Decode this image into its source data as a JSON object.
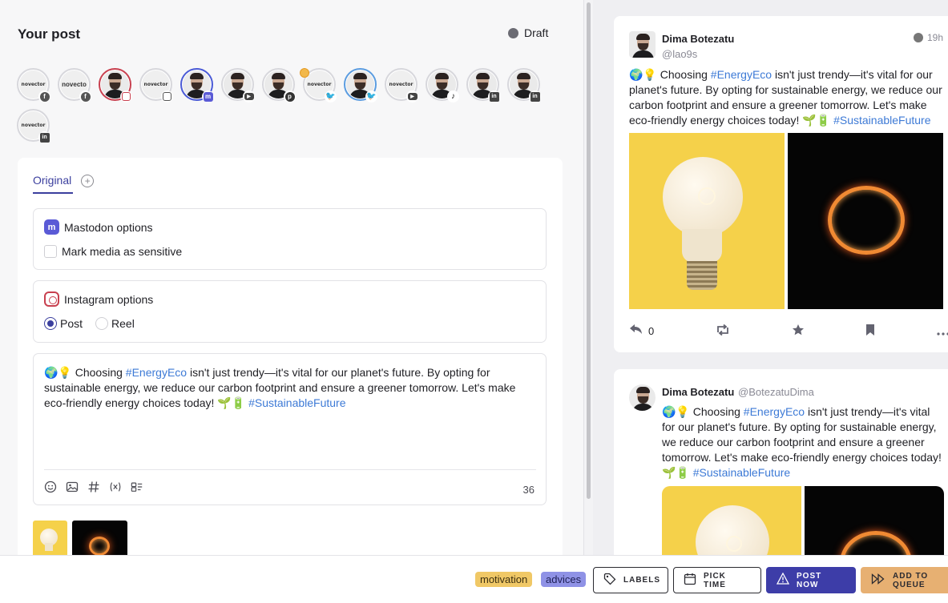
{
  "header": {
    "title": "Your post",
    "status": "Draft"
  },
  "accounts": [
    {
      "kind": "logo",
      "text": "novector",
      "network": "fb",
      "ring": "plain"
    },
    {
      "kind": "logo2",
      "text": "novecto",
      "network": "fb",
      "ring": "plain"
    },
    {
      "kind": "face",
      "network": "ig-red",
      "ring": "red"
    },
    {
      "kind": "logo",
      "text": "novector",
      "network": "ig",
      "ring": "plain"
    },
    {
      "kind": "face",
      "network": "md",
      "ring": "blue"
    },
    {
      "kind": "face",
      "network": "yt",
      "ring": "plain"
    },
    {
      "kind": "face",
      "network": "pt",
      "ring": "plain"
    },
    {
      "kind": "logo",
      "text": "novector",
      "network": "tw",
      "ring": "plain",
      "coin": true
    },
    {
      "kind": "face",
      "network": "twb",
      "ring": "tw"
    },
    {
      "kind": "logo",
      "text": "novector",
      "network": "yt",
      "ring": "plain"
    },
    {
      "kind": "face",
      "network": "tk",
      "ring": "plain"
    },
    {
      "kind": "face",
      "network": "li",
      "ring": "plain"
    },
    {
      "kind": "face",
      "network": "li",
      "ring": "plain"
    },
    {
      "kind": "logo",
      "text": "novector",
      "network": "li",
      "ring": "plain"
    }
  ],
  "editor": {
    "tab_original": "Original",
    "tab_add": "+",
    "mastodon": {
      "title": "Mastodon options",
      "sensitive_label": "Mark media as sensitive"
    },
    "instagram": {
      "title": "Instagram options",
      "post_label": "Post",
      "reel_label": "Reel",
      "selected": "Post"
    },
    "text_prefix": "🌍💡 Choosing ",
    "tag1": "#EnergyEco",
    "text_mid": " isn't just trendy—it's vital for our planet's future. By opting for sustainable energy, we reduce our carbon footprint and ensure a greener tomorrow. Let's make eco-friendly energy choices today! 🌱🔋 ",
    "tag2": "#SustainableFuture",
    "char_count": "36"
  },
  "preview_mastodon": {
    "name": "Dima Botezatu",
    "handle": "@lao9s",
    "time": "19h",
    "text_prefix": "🌍💡 Choosing ",
    "tag1": "#EnergyEco",
    "text_mid": " isn't just trendy—it's vital for our planet's future. By opting for sustainable energy, we reduce our carbon footprint and ensure a greener tomorrow. Let's make eco-friendly energy choices today! 🌱🔋 ",
    "tag2": "#SustainableFuture",
    "reply_count": "0"
  },
  "preview_twitter": {
    "name": "Dima Botezatu",
    "handle": "@BotezatuDima",
    "text_prefix": "🌍💡 Choosing ",
    "tag1": "#EnergyEco",
    "text_mid": " isn't just trendy—it's vital for our planet's future. By opting for sustainable energy, we reduce our carbon footprint and ensure a greener tomorrow. Let's make eco-friendly energy choices today! 🌱🔋 ",
    "tag2": "#SustainableFuture"
  },
  "bottom": {
    "labels": [
      "motivation",
      "advices"
    ],
    "btn_labels": "LABELS",
    "btn_pick_time": "PICK TIME",
    "btn_post_now": "POST NOW",
    "btn_add_queue": "ADD TO QUEUE"
  },
  "colors": {
    "accent": "#3d3da8",
    "hashtag": "#3d7ad6",
    "motivation": "#f0c866",
    "advices": "#8f92e6",
    "queue": "#e7b072"
  }
}
